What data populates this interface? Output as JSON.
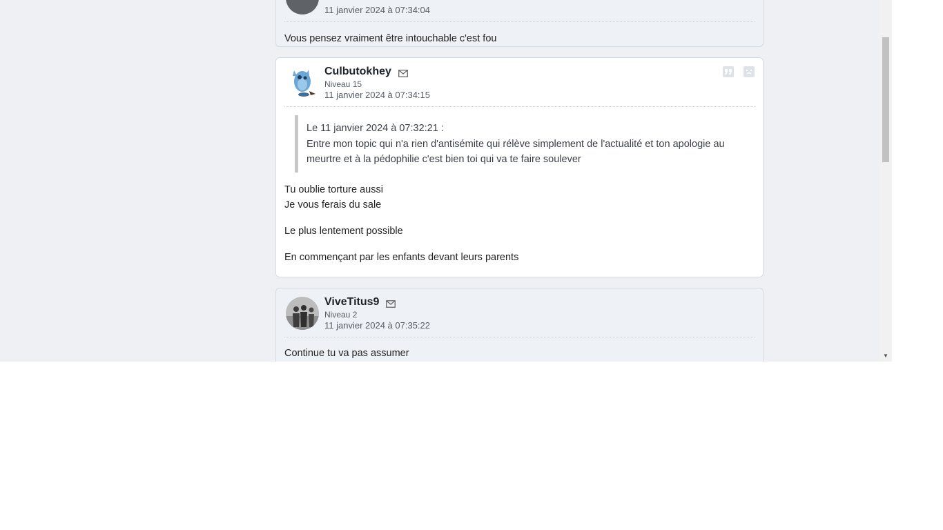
{
  "posts": [
    {
      "date": "11 janvier 2024 à 07:34:04",
      "body": [
        "Vous pensez vraiment être intouchable c'est fou"
      ]
    },
    {
      "author": "Culbutokhey",
      "level": "Niveau 15",
      "date": "11 janvier 2024 à 07:34:15",
      "quote": {
        "header": "Le 11 janvier 2024 à 07:32:21 :",
        "text": "Entre mon topic qui n'a rien d'antisémite qui rélève simplement de l'actualité et ton apologie au meurtre et à la pédophilie c'est bien toi qui va te faire soulever"
      },
      "body": [
        "Tu oublie torture aussi",
        "Je vous ferais du sale",
        "Le plus lentement possible",
        "En commençant par les enfants devant leurs parents"
      ],
      "actions": {
        "quote_icon": "quote-icon",
        "report_icon": "report-icon"
      }
    },
    {
      "author": "ViveTitus9",
      "level": "Niveau 2",
      "date": "11 janvier 2024 à 07:35:22",
      "body": [
        "Continue tu va pas assumer"
      ]
    }
  ],
  "colors": {
    "page_bg": "#eef0f4",
    "post_bg": "#eef1f5",
    "post_highlight_bg": "#ffffff",
    "border": "#d6dbe3",
    "quote_bar": "#c8c8c8"
  }
}
